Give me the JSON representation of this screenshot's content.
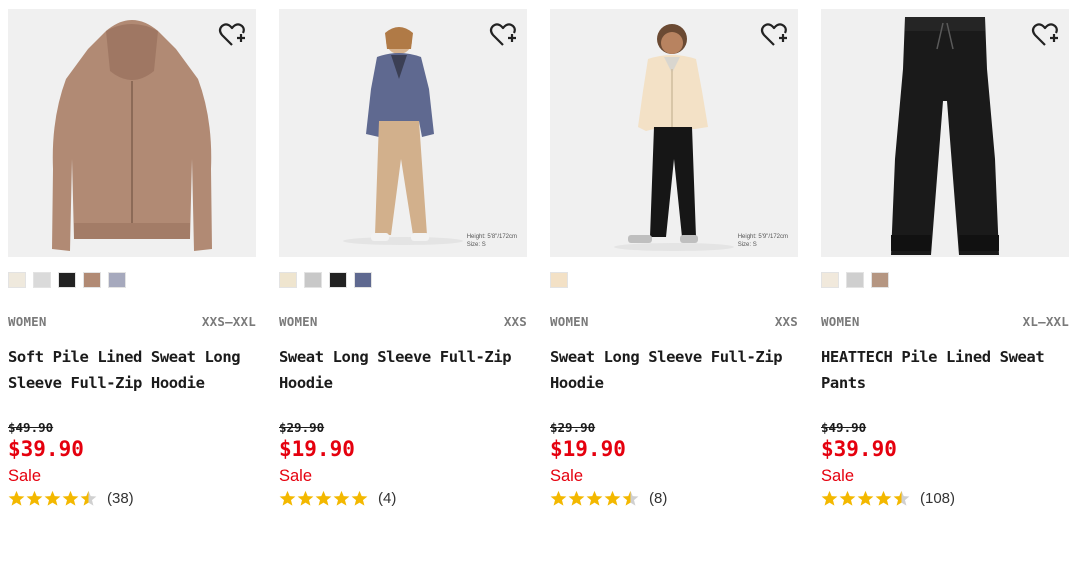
{
  "products": [
    {
      "category": "WOMEN",
      "sizes": "XXS–XXL",
      "name": "Soft Pile Lined Sweat Long Sleeve Full-Zip Hoodie",
      "original_price": "$49.90",
      "price": "$39.90",
      "flag": "Sale",
      "rating": 4.5,
      "review_count": "(38)",
      "swatches": [
        "#efe9dd",
        "#dadada",
        "#222222",
        "#b18a74",
        "#a6a9bd"
      ],
      "image_caption": [
        "",
        ""
      ],
      "image_icon": "hoodie-product-image"
    },
    {
      "category": "WOMEN",
      "sizes": "XXS",
      "name": "Sweat Long Sleeve Full-Zip Hoodie",
      "original_price": "$29.90",
      "price": "$19.90",
      "flag": "Sale",
      "rating": 5,
      "review_count": "(4)",
      "swatches": [
        "#efe5cf",
        "#c8c8c8",
        "#222222",
        "#5f6990"
      ],
      "image_caption": [
        "Height: 5'8\"/172cm",
        "Size: S"
      ],
      "image_icon": "model-wearing-blue-hoodie"
    },
    {
      "category": "WOMEN",
      "sizes": "XXS",
      "name": "Sweat Long Sleeve Full-Zip Hoodie",
      "original_price": "$29.90",
      "price": "$19.90",
      "flag": "Sale",
      "rating": 4.5,
      "review_count": "(8)",
      "swatches": [
        "#f3e1c6"
      ],
      "image_caption": [
        "Height: 5'9\"/172cm",
        "Size: S"
      ],
      "image_icon": "model-wearing-cream-hoodie"
    },
    {
      "category": "WOMEN",
      "sizes": "XL–XXL",
      "name": "HEATTECH Pile Lined Sweat Pants",
      "original_price": "$49.90",
      "price": "$39.90",
      "flag": "Sale",
      "rating": 4.5,
      "review_count": "(108)",
      "swatches": [
        "#f1e9dc",
        "#cfcfcf",
        "#b59682"
      ],
      "image_caption": [
        "",
        ""
      ],
      "image_icon": "black-sweat-pants-image"
    }
  ],
  "colors": {
    "sale_red": "#e5000e",
    "star_gold": "#f3b800",
    "image_bg": "#f0f0f0"
  },
  "icons": {
    "wishlist": "heart-plus-icon",
    "star": "star-icon"
  }
}
